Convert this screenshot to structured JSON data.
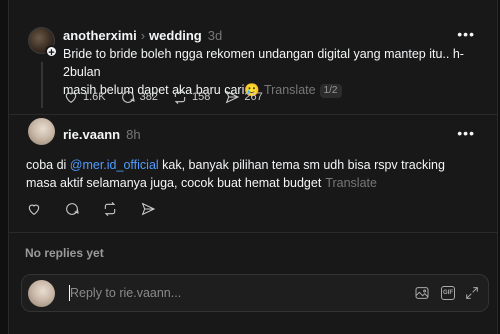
{
  "post1": {
    "username": "anotherximi",
    "topic": "wedding",
    "time": "3d",
    "text_line1": "Bride to bride boleh ngga rekomen undangan digital yang mantep itu.. h-2bulan",
    "text_line2": "masih belum dapet aka baru cari",
    "emoji": "🥲",
    "translate": "Translate",
    "pager": "1/2",
    "likes": "1.6K",
    "comments": "382",
    "reposts": "158",
    "shares": "267"
  },
  "post2": {
    "username": "rie.vaann",
    "time": "8h",
    "text_pre": "coba di ",
    "mention": "@mer.id_official",
    "text_post": " kak, banyak pilihan tema sm udh bisa rspv tracking",
    "text_line2": "masa aktif selamanya juga, cocok buat hemat budget",
    "translate": "Translate"
  },
  "no_replies": "No replies yet",
  "reply": {
    "placeholder": "Reply to rie.vaann..."
  },
  "icons": {
    "more": "more-horizontal-icon",
    "like": "heart-icon",
    "comment": "comment-icon",
    "repost": "repost-icon",
    "share": "send-icon",
    "image": "image-icon",
    "gif": "gif-icon",
    "expand": "expand-icon"
  }
}
